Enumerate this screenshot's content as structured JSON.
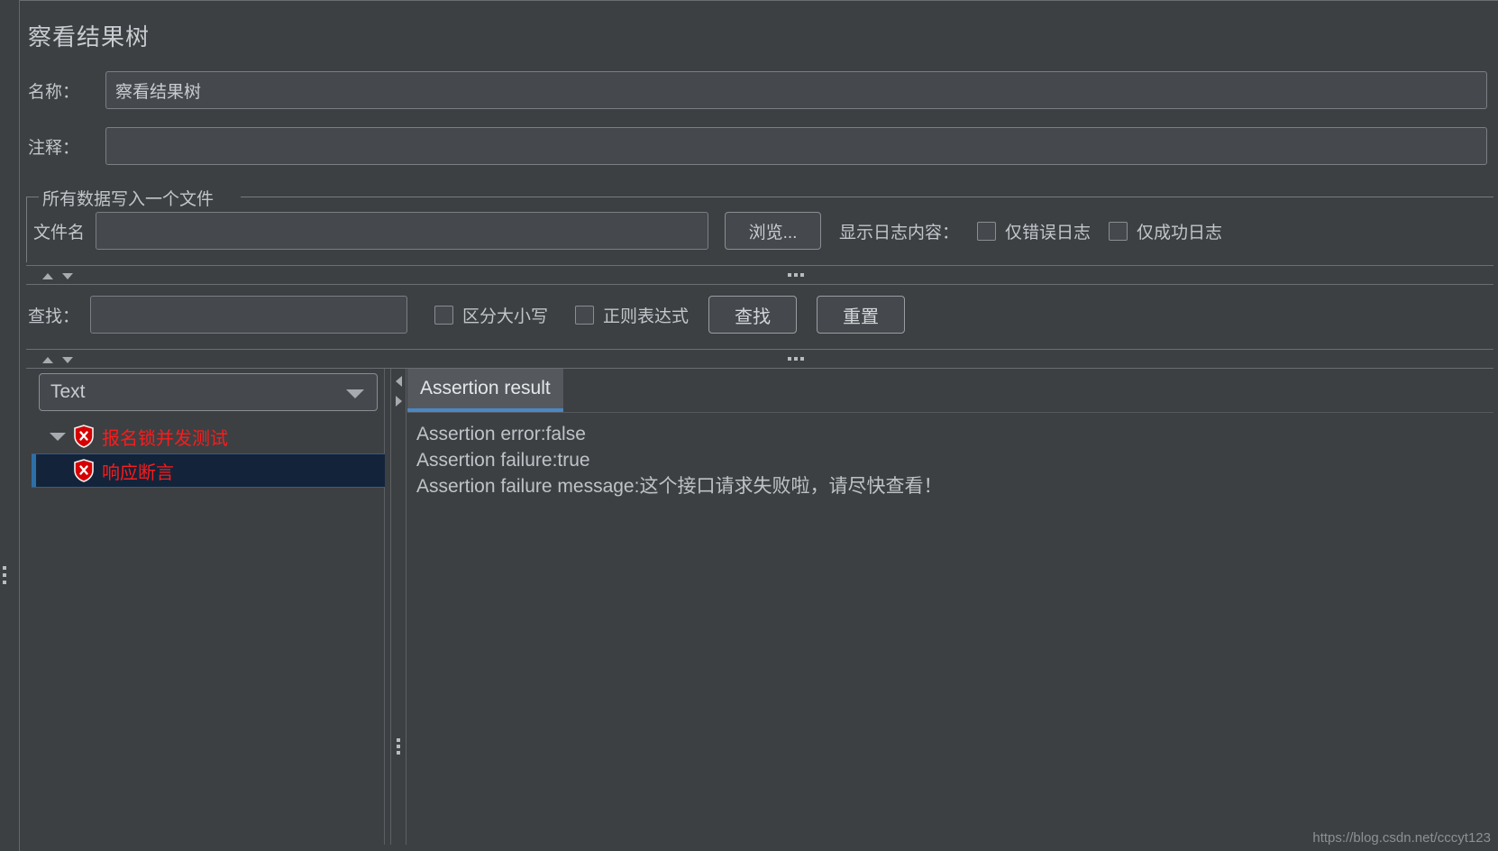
{
  "panel": {
    "title": "察看结果树",
    "name_label": "名称：",
    "name_value": "察看结果树",
    "comment_label": "注释：",
    "comment_value": ""
  },
  "file_group": {
    "title": "所有数据写入一个文件",
    "filename_label": "文件名",
    "filename_value": "",
    "browse_button": "浏览...",
    "show_log_label": "显示日志内容：",
    "checkboxes": [
      {
        "label": "仅错误日志",
        "checked": false
      },
      {
        "label": "仅成功日志",
        "checked": false
      }
    ]
  },
  "find_bar": {
    "label": "查找：",
    "value": "",
    "checkboxes": [
      {
        "label": "区分大小写",
        "checked": false
      },
      {
        "label": "正则表达式",
        "checked": false
      }
    ],
    "find_button": "查找",
    "reset_button": "重置"
  },
  "renderer": {
    "selected": "Text"
  },
  "tree": {
    "nodes": [
      {
        "label": "报名锁并发测试",
        "level": 0,
        "expanded": true,
        "selected": false,
        "status": "error"
      },
      {
        "label": "响应断言",
        "level": 1,
        "expanded": false,
        "selected": true,
        "status": "error"
      }
    ]
  },
  "result_tabs": {
    "tabs": [
      {
        "label": "Assertion result",
        "active": true
      }
    ],
    "lines": [
      "Assertion error:false",
      "Assertion failure:true",
      "Assertion failure message:这个接口请求失败啦，请尽快查看！"
    ]
  },
  "watermark": "https://blog.csdn.net/cccyt123",
  "colors": {
    "background": "#3c4043",
    "accent": "#4a87c7",
    "error_text": "#fc1b1b",
    "selection": "#13243a"
  }
}
